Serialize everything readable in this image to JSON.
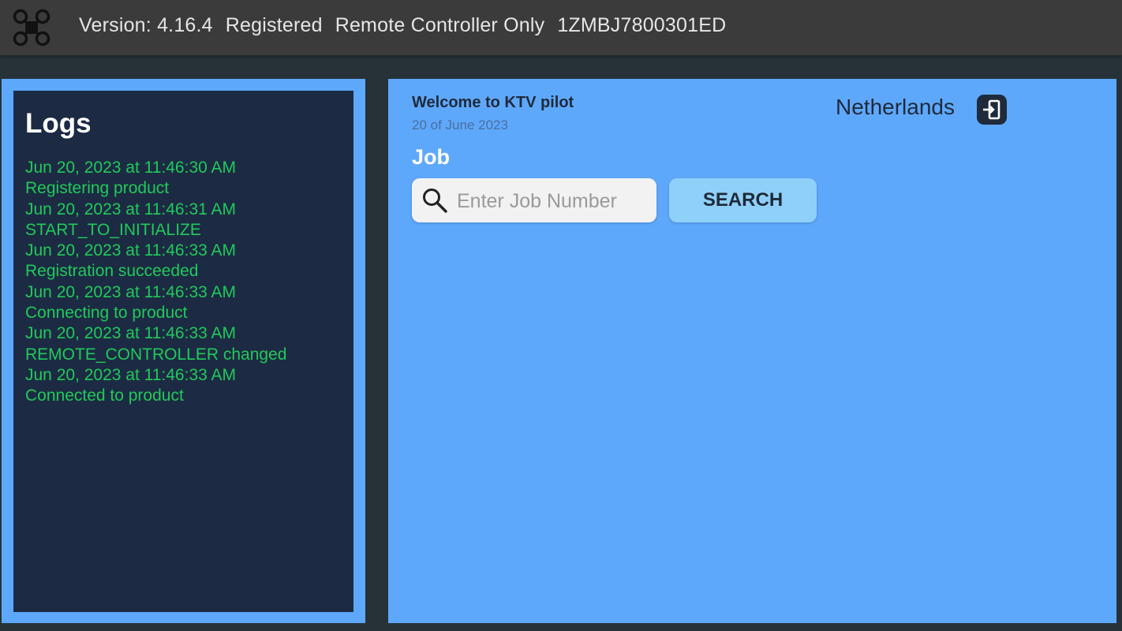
{
  "topbar": {
    "icon": "drone-icon",
    "version": "Version: 4.16.4",
    "registration": "Registered",
    "mode": "Remote Controller Only",
    "serial": "1ZMBJ7800301ED"
  },
  "logs": {
    "title": "Logs",
    "lines": [
      "Jun 20, 2023 at 11:46:30 AM",
      "Registering product",
      "Jun 20, 2023 at 11:46:31 AM",
      "START_TO_INITIALIZE",
      "Jun 20, 2023 at 11:46:33 AM",
      "Registration succeeded",
      "Jun 20, 2023 at 11:46:33 AM",
      "Connecting to product",
      "Jun 20, 2023 at 11:46:33 AM",
      "REMOTE_CONTROLLER changed",
      "Jun 20, 2023 at 11:46:33 AM",
      "Connected to product"
    ]
  },
  "main": {
    "welcome": "Welcome to KTV pilot",
    "date": "20 of June 2023",
    "country": "Netherlands",
    "logout_icon": "logout-icon",
    "job_label": "Job",
    "search": {
      "placeholder": "Enter Job Number",
      "value": "",
      "button_label": "SEARCH"
    }
  },
  "colors": {
    "topbar": "#3b3b3b",
    "panel_blue": "#5ea8fc",
    "logs_bg": "#1c2b43",
    "log_text": "#21c95a",
    "button": "#8fd0f8"
  }
}
